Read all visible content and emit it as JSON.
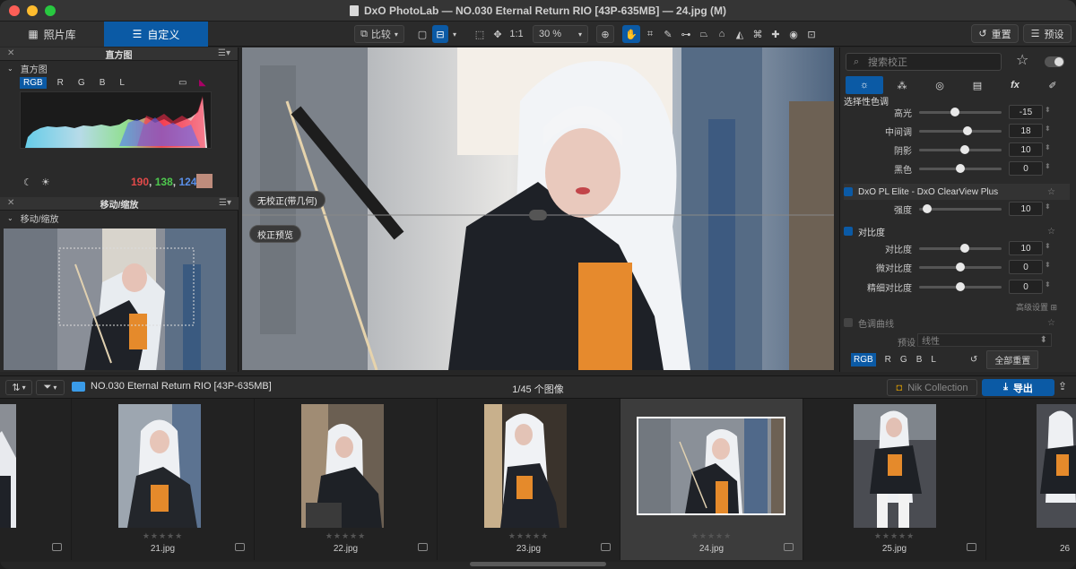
{
  "window": {
    "title": "DxO PhotoLab — NO.030 Eternal Return RIO [43P-635MB] — 24.jpg (M)"
  },
  "toolbar": {
    "tab_library": "照片库",
    "tab_customize": "自定义",
    "compare_label": "比较",
    "zoom_one": "1:1",
    "zoom_value": "30 %",
    "reset_label": "重置",
    "preset_label": "预设"
  },
  "histogram": {
    "title": "直方图",
    "subtitle": "直方图",
    "channels": [
      "RGB",
      "R",
      "G",
      "B",
      "L"
    ],
    "rgb_r": "190",
    "rgb_g": "138",
    "rgb_b": "124",
    "sep": ","
  },
  "navigator": {
    "title": "移动/缩放",
    "subtitle": "移动/缩放"
  },
  "viewer": {
    "pill_no_correction": "无校正(带几何)",
    "pill_preview": "校正预览"
  },
  "right_panel": {
    "search_placeholder": "搜索校正",
    "section_selective_tone": "选择性色调",
    "sliders_tone": [
      {
        "label": "高光",
        "value": "-15",
        "pos": 0.43
      },
      {
        "label": "中间调",
        "value": "18",
        "pos": 0.59
      },
      {
        "label": "阴影",
        "value": "10",
        "pos": 0.55
      },
      {
        "label": "黑色",
        "value": "0",
        "pos": 0.5
      }
    ],
    "section_clearview": "DxO PL Elite - DxO ClearView Plus",
    "clearview_slider": {
      "label": "强度",
      "value": "10",
      "pos": 0.1
    },
    "section_contrast": "对比度",
    "sliders_contrast": [
      {
        "label": "对比度",
        "value": "10",
        "pos": 0.55
      },
      {
        "label": "微对比度",
        "value": "0",
        "pos": 0.5
      },
      {
        "label": "精细对比度",
        "value": "0",
        "pos": 0.5
      }
    ],
    "advanced_label": "高级设置",
    "section_curve": "色调曲线",
    "curve_preset_label": "预设",
    "curve_preset_value": "线性",
    "curve_channels": [
      "RGB",
      "R",
      "G",
      "B",
      "L"
    ],
    "reset_all": "全部重置"
  },
  "filmbar": {
    "folder": "NO.030 Eternal Return RIO [43P-635MB]",
    "count": "1/45 个图像",
    "nik": "Nik Collection",
    "export": "导出"
  },
  "filmstrip": {
    "stars": "★★★★★",
    "items": [
      {
        "name": "21.jpg"
      },
      {
        "name": "22.jpg"
      },
      {
        "name": "23.jpg"
      },
      {
        "name": "24.jpg"
      },
      {
        "name": "25.jpg"
      },
      {
        "name": "26"
      }
    ]
  },
  "colors": {
    "accent": "#0b5aa5",
    "swatch": "#be8c7c",
    "r": "#e34a4a",
    "g": "#4ec84e",
    "b": "#5a8fe8"
  }
}
